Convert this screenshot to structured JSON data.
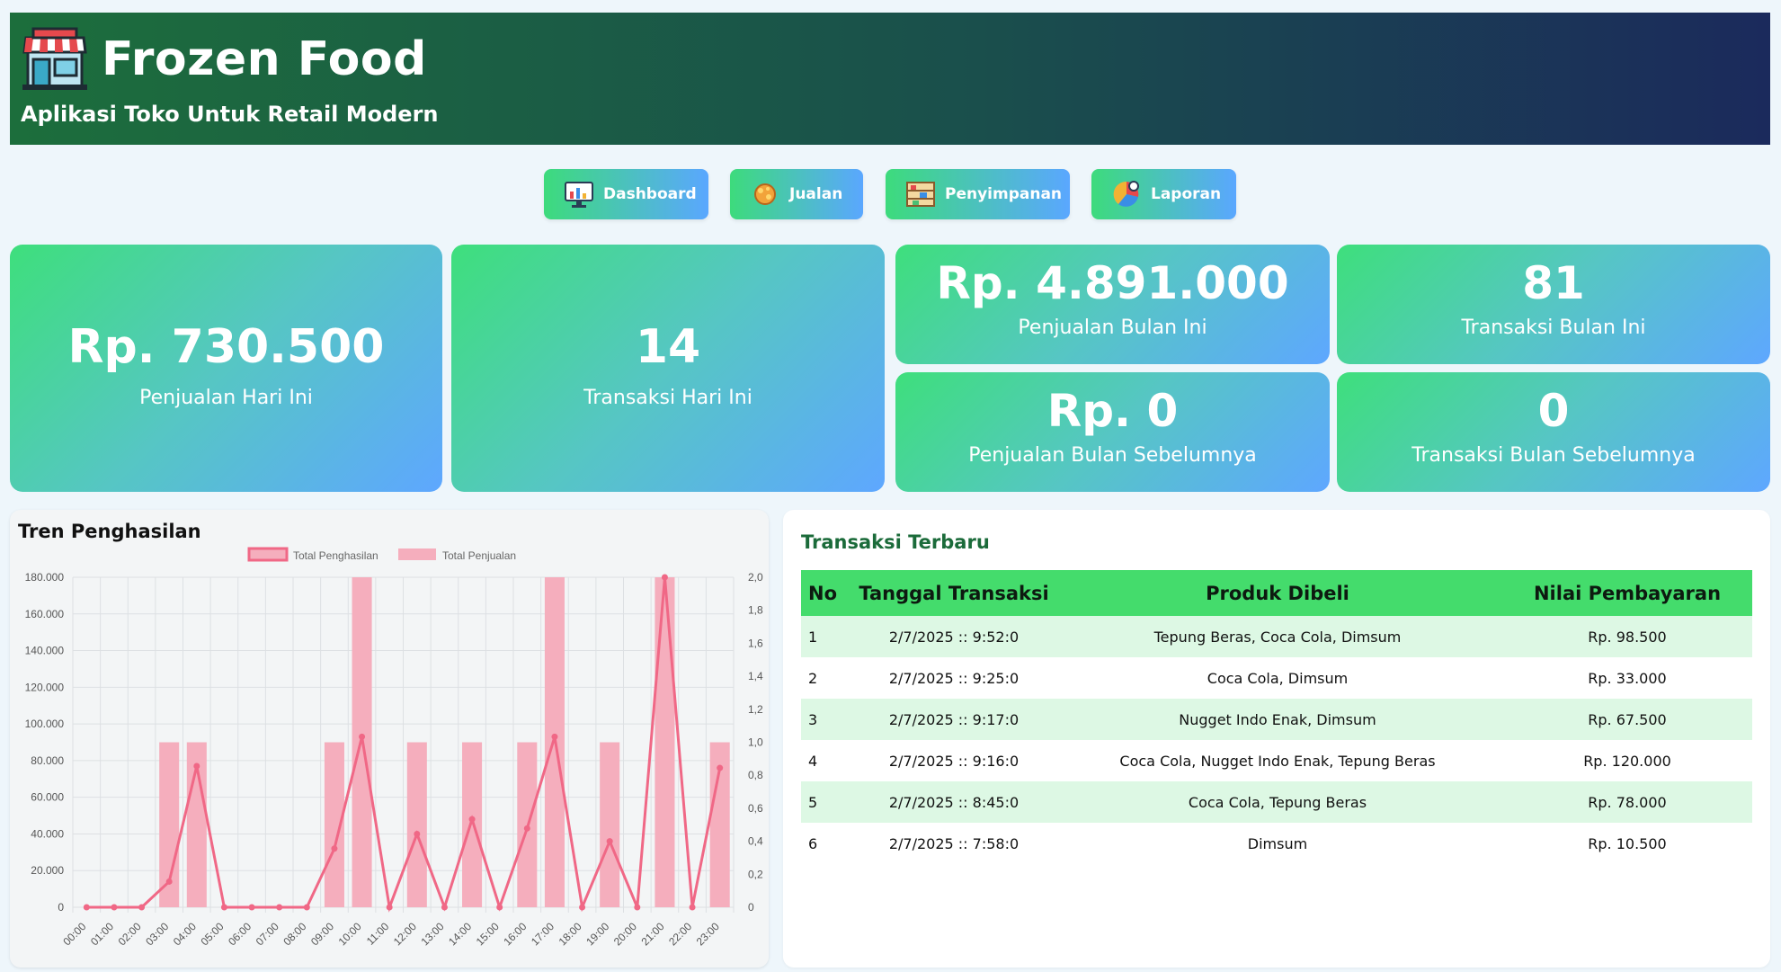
{
  "app": {
    "title": "Frozen Food",
    "subtitle": "Aplikasi Toko Untuk Retail Modern"
  },
  "nav": {
    "dashboard": "Dashboard",
    "jualan": "Jualan",
    "penyimpanan": "Penyimpanan",
    "laporan": "Laporan"
  },
  "stats": {
    "sales_today": {
      "value": "Rp. 730.500",
      "label": "Penjualan Hari Ini"
    },
    "tx_today": {
      "value": "14",
      "label": "Transaksi Hari Ini"
    },
    "sales_month": {
      "value": "Rp. 4.891.000",
      "label": "Penjualan Bulan Ini"
    },
    "tx_month": {
      "value": "81",
      "label": "Transaksi Bulan Ini"
    },
    "sales_prev": {
      "value": "Rp. 0",
      "label": "Penjualan Bulan Sebelumnya"
    },
    "tx_prev": {
      "value": "0",
      "label": "Transaksi Bulan Sebelumnya"
    }
  },
  "chart_panel": {
    "title": "Tren Penghasilan"
  },
  "chart_data": {
    "type": "bar",
    "categories": [
      "00:00",
      "01:00",
      "02:00",
      "03:00",
      "04:00",
      "05:00",
      "06:00",
      "07:00",
      "08:00",
      "09:00",
      "10:00",
      "11:00",
      "12:00",
      "13:00",
      "14:00",
      "15:00",
      "16:00",
      "17:00",
      "18:00",
      "19:00",
      "20:00",
      "21:00",
      "22:00",
      "23:00"
    ],
    "series": [
      {
        "name": "Total Penghasilan",
        "type": "line",
        "axis": "left",
        "values": [
          0,
          0,
          0,
          14000,
          77000,
          0,
          0,
          0,
          0,
          32000,
          93000,
          0,
          40000,
          0,
          48000,
          0,
          43000,
          93000,
          0,
          36000,
          0,
          180000,
          0,
          76000
        ]
      },
      {
        "name": "Total Penjualan",
        "type": "bar",
        "axis": "right",
        "values": [
          0,
          0,
          0,
          1,
          1,
          0,
          0,
          0,
          0,
          1,
          2,
          0,
          1,
          0,
          1,
          0,
          1,
          2,
          0,
          1,
          0,
          2,
          0,
          1
        ]
      }
    ],
    "y_left": {
      "min": 0,
      "max": 180000,
      "ticks": [
        "180.000",
        "160.000",
        "140.000",
        "120.000",
        "100.000",
        "80.000",
        "60.000",
        "40.000",
        "20.000",
        "0"
      ]
    },
    "y_right": {
      "min": 0,
      "max": 2,
      "ticks": [
        "2,0",
        "1,8",
        "1,6",
        "1,4",
        "1,2",
        "1,0",
        "0,8",
        "0,6",
        "0,4",
        "0,2",
        "0"
      ]
    },
    "legend_position": "top-center",
    "grid": true,
    "colors": {
      "line": "#f06886",
      "bar": "#f5aebd"
    }
  },
  "transactions": {
    "title": "Transaksi Terbaru",
    "headers": {
      "no": "No",
      "date": "Tanggal Transaksi",
      "products": "Produk Dibeli",
      "amount": "Nilai Pembayaran"
    },
    "rows": [
      {
        "no": "1",
        "date": "2/7/2025 :: 9:52:0",
        "products": "Tepung Beras, Coca Cola, Dimsum",
        "amount": "Rp. 98.500"
      },
      {
        "no": "2",
        "date": "2/7/2025 :: 9:25:0",
        "products": "Coca Cola, Dimsum",
        "amount": "Rp. 33.000"
      },
      {
        "no": "3",
        "date": "2/7/2025 :: 9:17:0",
        "products": "Nugget Indo Enak, Dimsum",
        "amount": "Rp. 67.500"
      },
      {
        "no": "4",
        "date": "2/7/2025 :: 9:16:0",
        "products": "Coca Cola, Nugget Indo Enak, Tepung Beras",
        "amount": "Rp. 120.000"
      },
      {
        "no": "5",
        "date": "2/7/2025 :: 8:45:0",
        "products": "Coca Cola, Tepung Beras",
        "amount": "Rp. 78.000"
      },
      {
        "no": "6",
        "date": "2/7/2025 :: 7:58:0",
        "products": "Dimsum",
        "amount": "Rp. 10.500"
      }
    ]
  }
}
